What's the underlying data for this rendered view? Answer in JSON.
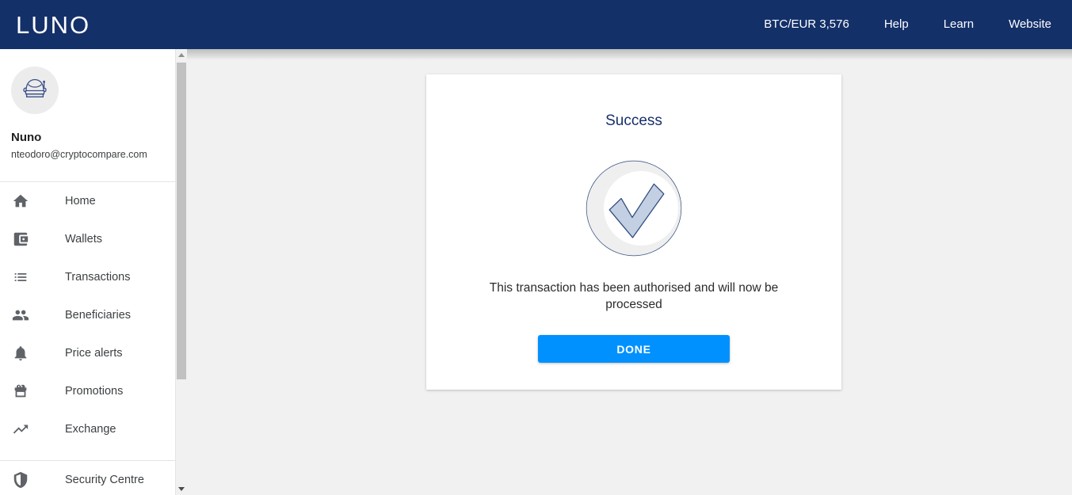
{
  "header": {
    "logo": "LUNO",
    "nav": [
      {
        "label": "BTC/EUR 3,576",
        "name": "btc-eur-rate"
      },
      {
        "label": "Help",
        "name": "help"
      },
      {
        "label": "Learn",
        "name": "learn"
      },
      {
        "label": "Website",
        "name": "website"
      }
    ],
    "background_color": "#143069"
  },
  "sidebar": {
    "avatar_icon": "astronaut-helmet-icon",
    "profile": {
      "name": "Nuno",
      "email": "nteodoro@cryptocompare.com"
    },
    "items": [
      {
        "label": "Home",
        "icon": "home-icon"
      },
      {
        "label": "Wallets",
        "icon": "wallet-icon"
      },
      {
        "label": "Transactions",
        "icon": "list-icon"
      },
      {
        "label": "Beneficiaries",
        "icon": "people-icon"
      },
      {
        "label": "Price alerts",
        "icon": "bell-icon"
      },
      {
        "label": "Promotions",
        "icon": "gift-icon"
      },
      {
        "label": "Exchange",
        "icon": "trending-up-icon"
      }
    ],
    "items_bottom": [
      {
        "label": "Security Centre",
        "icon": "shield-icon"
      }
    ]
  },
  "scrollbar": {
    "up_arrow": "chevron-up-icon",
    "down_arrow": "chevron-down-icon"
  },
  "card": {
    "title": "Success",
    "status_icon": "check-circle-icon",
    "message": "This transaction has been authorised and will now be processed",
    "done_label": "DONE",
    "accent_color": "#0091ff",
    "title_color": "#17306b"
  }
}
